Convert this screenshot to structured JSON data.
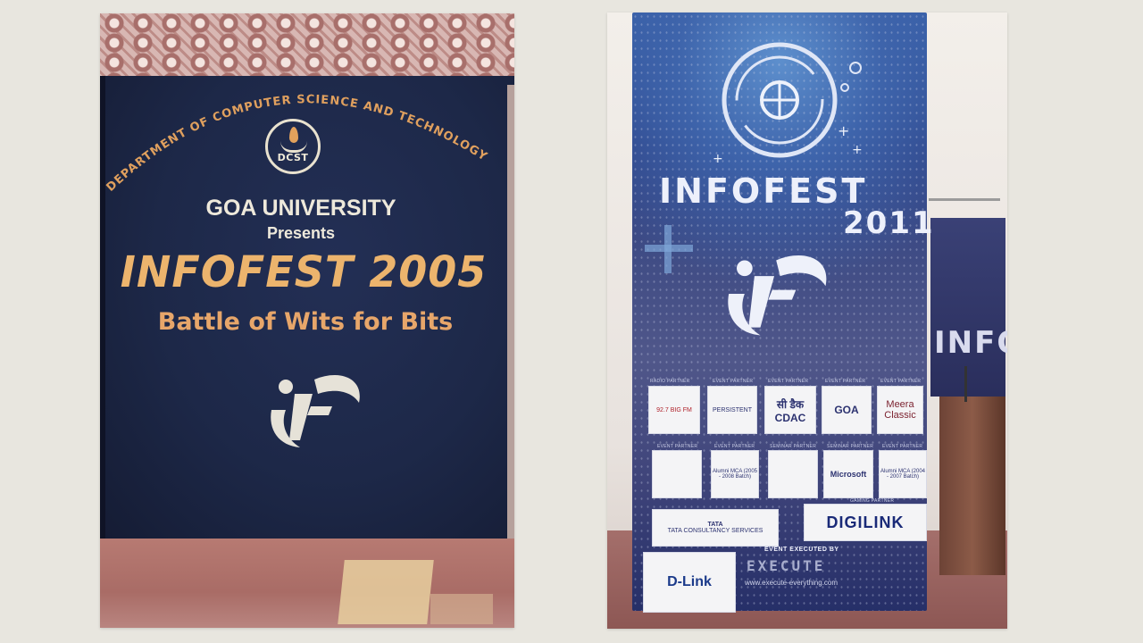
{
  "left_photo": {
    "department": "DEPARTMENT OF COMPUTER SCIENCE AND TECHNOLOGY",
    "logo_text": "DCST",
    "university": "GOA UNIVERSITY",
    "presents": "Presents",
    "title": "INFOFEST 2005",
    "tagline": "Battle of Wits for Bits",
    "mascot_icon": "if-logo"
  },
  "right_photo": {
    "title": "INFOFEST",
    "year": "2011",
    "side_banner_text": "INFOR",
    "mascot_icon": "if-logo",
    "sponsors": [
      {
        "caption": "Radio Partner",
        "name": "92.7 BIG FM"
      },
      {
        "caption": "Event Partner",
        "name": "PERSISTENT"
      },
      {
        "caption": "Event Partner",
        "name": "सी डैक CDAC"
      },
      {
        "caption": "Event Partner",
        "name": "GOA"
      },
      {
        "caption": "Event Partner",
        "name": "Meera Classic"
      },
      {
        "caption": "Event Partner",
        "name": ""
      },
      {
        "caption": "Event Partner",
        "name": "Alumni MCA (2005 - 2008 Batch)"
      },
      {
        "caption": "Seminar Partner",
        "name": ""
      },
      {
        "caption": "Seminar Partner",
        "name": "Microsoft"
      },
      {
        "caption": "Event Partner",
        "name": "Alumni MCA (2004 - 2007 Batch)"
      }
    ],
    "tcs": "TATA CONSULTANCY SERVICES",
    "tcs_small": "TATA",
    "gaming_caption": "Gaming Partner",
    "digilink": "DIGILINK",
    "dlink": "D-Link",
    "executed_by": "EVENT EXECUTED BY",
    "executed_brand": "EXECUTE",
    "executed_url": "www.execute-everything.com"
  },
  "colors": {
    "page_bg": "#e8e6df",
    "banner_navy": "#1d2848",
    "banner_orange": "#ecb46d",
    "rollup_blue": "#2c3f83"
  }
}
